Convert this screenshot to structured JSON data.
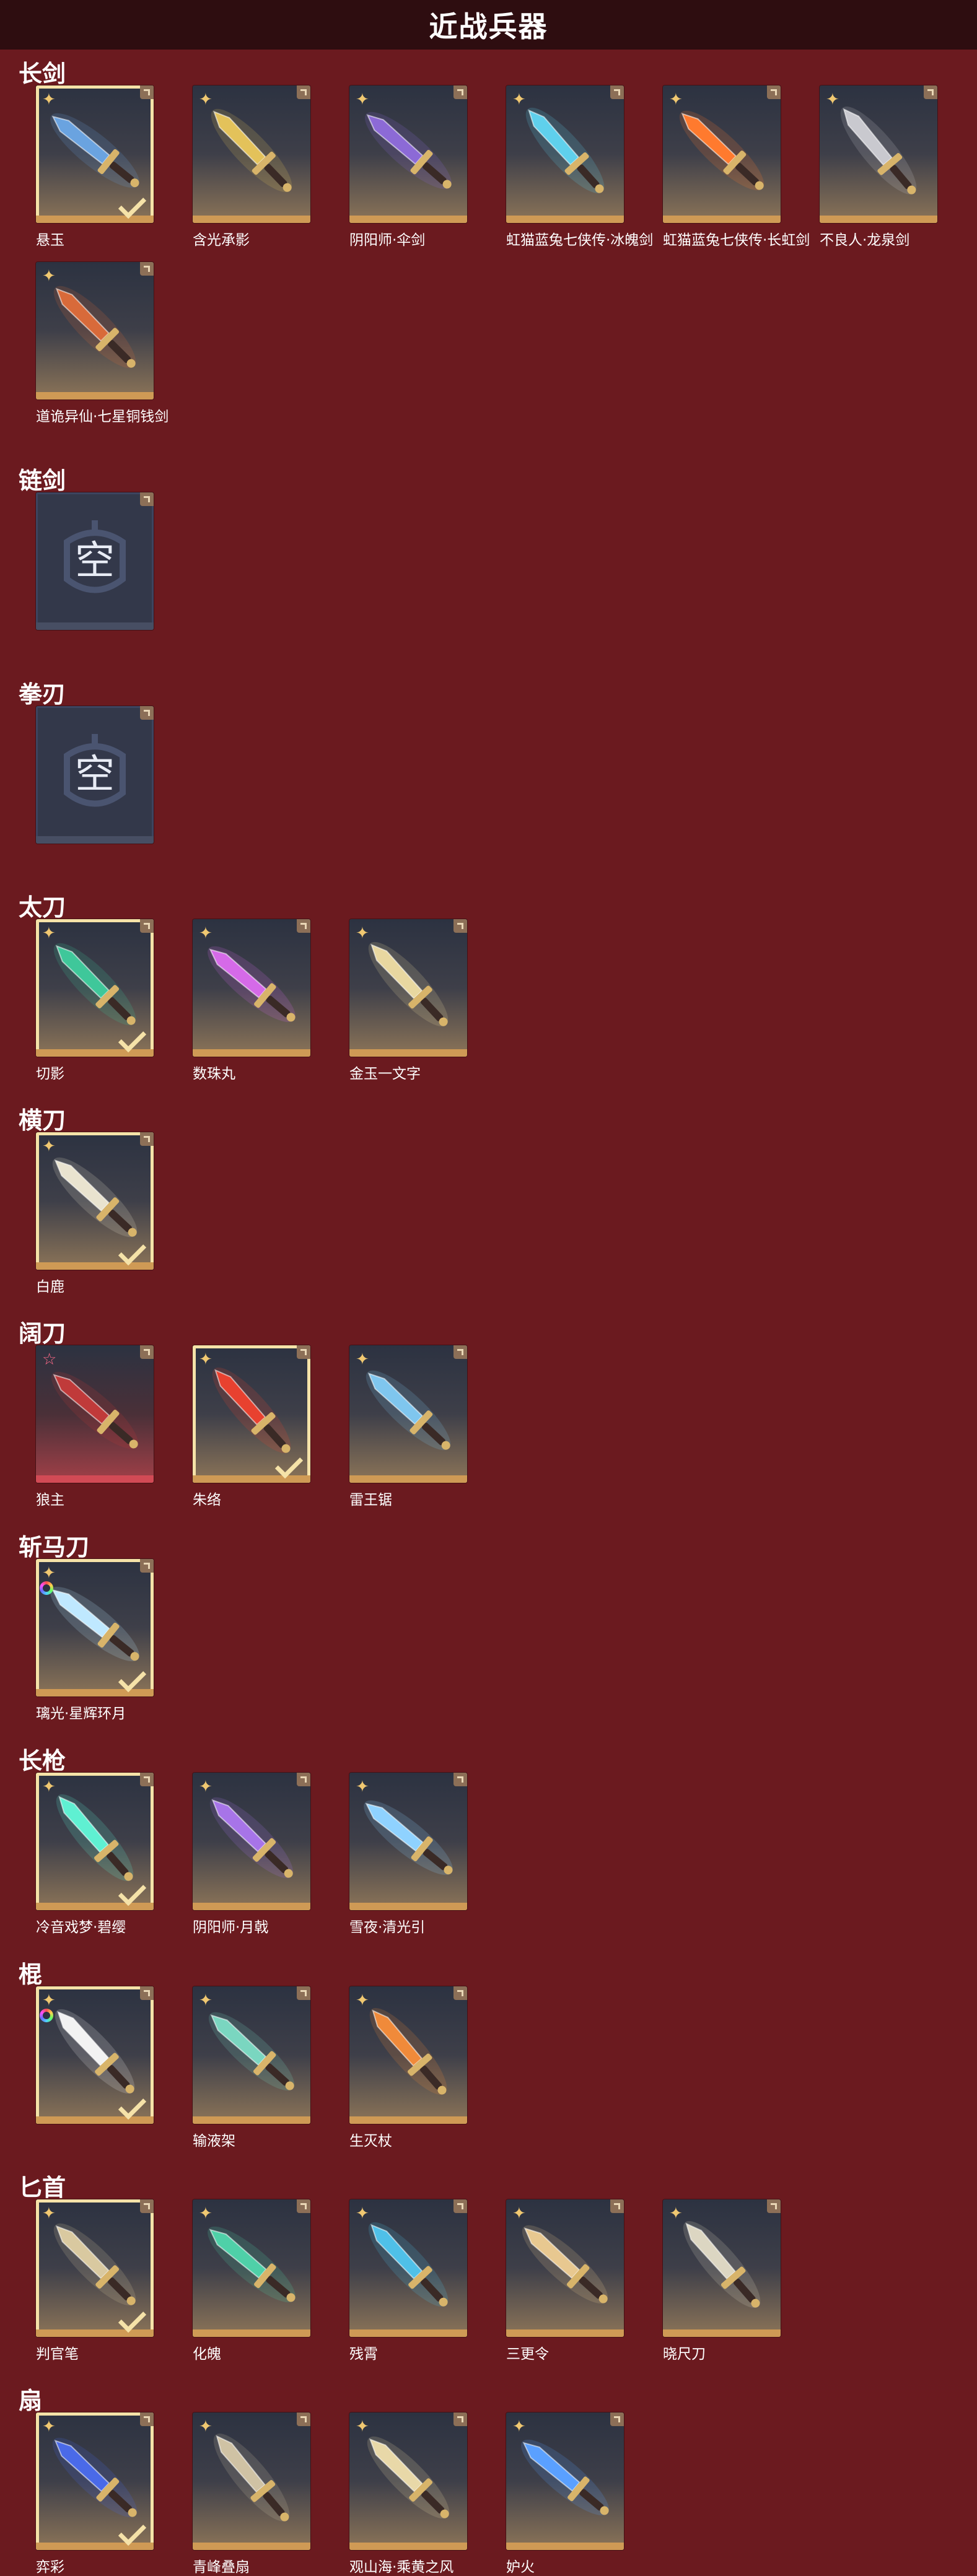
{
  "header": {
    "title": "近战兵器"
  },
  "colors": {
    "background": "#6b1a1f",
    "header": "#2e0d10",
    "card_bar": "#cf9a55",
    "owned_outline": "#f5e2a8"
  },
  "categories": [
    {
      "title": "长剑",
      "items": [
        {
          "name": "悬玉",
          "badge": "star",
          "owned": true,
          "color": "#6aa3e0"
        },
        {
          "name": "含光承影",
          "badge": "star",
          "owned": false,
          "color": "#e3c25a"
        },
        {
          "name": "阴阳师·伞剑",
          "badge": "star",
          "owned": false,
          "color": "#8c6ad6"
        },
        {
          "name": "虹猫蓝兔七侠传·冰魄剑",
          "badge": "star",
          "owned": false,
          "color": "#5fd0ec"
        },
        {
          "name": "虹猫蓝兔七侠传·长虹剑",
          "badge": "star",
          "owned": false,
          "color": "#ff7a2e"
        },
        {
          "name": "不良人·龙泉剑",
          "badge": "star",
          "owned": false,
          "color": "#c9c9cf"
        },
        {
          "name": "道诡异仙·七星铜钱剑",
          "badge": "star",
          "owned": false,
          "color": "#d86a3a"
        }
      ]
    },
    {
      "title": "链剑",
      "items": [
        {
          "name": "",
          "badge": "none",
          "owned": false,
          "empty": true,
          "empty_text": "空"
        }
      ]
    },
    {
      "title": "拳刃",
      "items": [
        {
          "name": "",
          "badge": "none",
          "owned": false,
          "empty": true,
          "empty_text": "空"
        }
      ]
    },
    {
      "title": "太刀",
      "items": [
        {
          "name": "切影",
          "badge": "star",
          "owned": true,
          "color": "#3fc79a"
        },
        {
          "name": "数珠丸",
          "badge": "star",
          "owned": false,
          "color": "#d56ae8"
        },
        {
          "name": "金玉一文字",
          "badge": "star",
          "owned": false,
          "color": "#e8d7a0"
        }
      ]
    },
    {
      "title": "横刀",
      "items": [
        {
          "name": "白鹿",
          "badge": "star",
          "owned": true,
          "color": "#e9e3cf"
        }
      ]
    },
    {
      "title": "阔刀",
      "items": [
        {
          "name": "狼主",
          "badge": "pink",
          "owned": false,
          "red": true,
          "color": "#c03a3a"
        },
        {
          "name": "朱络",
          "badge": "star",
          "owned": true,
          "color": "#e8412f"
        },
        {
          "name": "雷王锯",
          "badge": "star",
          "owned": false,
          "color": "#7fc6ee"
        }
      ]
    },
    {
      "title": "斩马刀",
      "items": [
        {
          "name": "璃光·星辉环月",
          "badge": "rainbow",
          "owned": true,
          "color": "#bfe8ff"
        }
      ]
    },
    {
      "title": "长枪",
      "items": [
        {
          "name": "冷音戏梦·碧缨",
          "badge": "star",
          "owned": true,
          "color": "#5ff0d2"
        },
        {
          "name": "阴阳师·月戟",
          "badge": "star",
          "owned": false,
          "color": "#a774e8"
        },
        {
          "name": "雪夜·清光引",
          "badge": "star",
          "owned": false,
          "color": "#8fd2ff"
        }
      ]
    },
    {
      "title": "棍",
      "items": [
        {
          "name": "",
          "badge": "rainbow",
          "owned": true,
          "color": "#f2f2f2"
        },
        {
          "name": "输液架",
          "badge": "star",
          "owned": false,
          "color": "#7ad6c0"
        },
        {
          "name": "生灭杖",
          "badge": "star",
          "owned": false,
          "color": "#f08a3a"
        }
      ]
    },
    {
      "title": "匕首",
      "items": [
        {
          "name": "判官笔",
          "badge": "star",
          "owned": true,
          "color": "#d9c9a0"
        },
        {
          "name": "化魄",
          "badge": "star",
          "owned": false,
          "color": "#4fd0a8"
        },
        {
          "name": "残霄",
          "badge": "star",
          "owned": false,
          "color": "#4fc0e8"
        },
        {
          "name": "三更令",
          "badge": "star",
          "owned": false,
          "color": "#e8c890"
        },
        {
          "name": "晓尺刀",
          "badge": "star",
          "owned": false,
          "color": "#dcd6c2"
        }
      ]
    },
    {
      "title": "扇",
      "items": [
        {
          "name": "弈彩",
          "badge": "star",
          "owned": true,
          "color": "#4a6ae8"
        },
        {
          "name": "青峰叠扇",
          "badge": "star",
          "owned": false,
          "color": "#cfc2a4"
        },
        {
          "name": "观山海·乘黄之风",
          "badge": "star",
          "owned": false,
          "color": "#e8d8a8"
        },
        {
          "name": "妒火",
          "badge": "star",
          "owned": false,
          "color": "#5aa0ff"
        }
      ]
    }
  ]
}
